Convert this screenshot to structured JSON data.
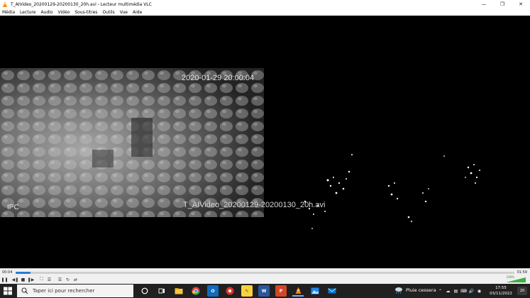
{
  "window": {
    "title": "T_AIVideo_20200129-20200130_20h.avi - Lecteur multimédia VLC",
    "minimize_icon": "minimize-icon",
    "maximize_icon": "maximize-icon",
    "close_icon": "close-icon"
  },
  "menu": {
    "items": [
      "Média",
      "Lecture",
      "Audio",
      "Vidéo",
      "Sous-titres",
      "Outils",
      "Vue",
      "Aide"
    ]
  },
  "video": {
    "timestamp": "2020-01-29 20:00:04",
    "camera_label": "IPC",
    "file_overlay": "T_AIVideo_20200129-20200130_20h.avi"
  },
  "controls": {
    "current_time": "00:04",
    "total_time": "01:59",
    "progress": 0.03,
    "volume_percent": "100%",
    "buttons": [
      "play-pause",
      "previous",
      "stop",
      "next",
      "fullscreen",
      "extended-settings",
      "playlist",
      "loop",
      "shuffle"
    ]
  },
  "taskbar": {
    "search_placeholder": "Taper ici pour rechercher",
    "weather_text": "Pluie cessera",
    "clock_time": "17:55",
    "clock_date": "03/11/2022",
    "notification_count": "20",
    "colors": {
      "chrome": "#e94235",
      "outlook": "#0f6cbd",
      "word": "#2b579a",
      "powerpoint": "#d24726",
      "vlc": "#ff8800"
    }
  }
}
